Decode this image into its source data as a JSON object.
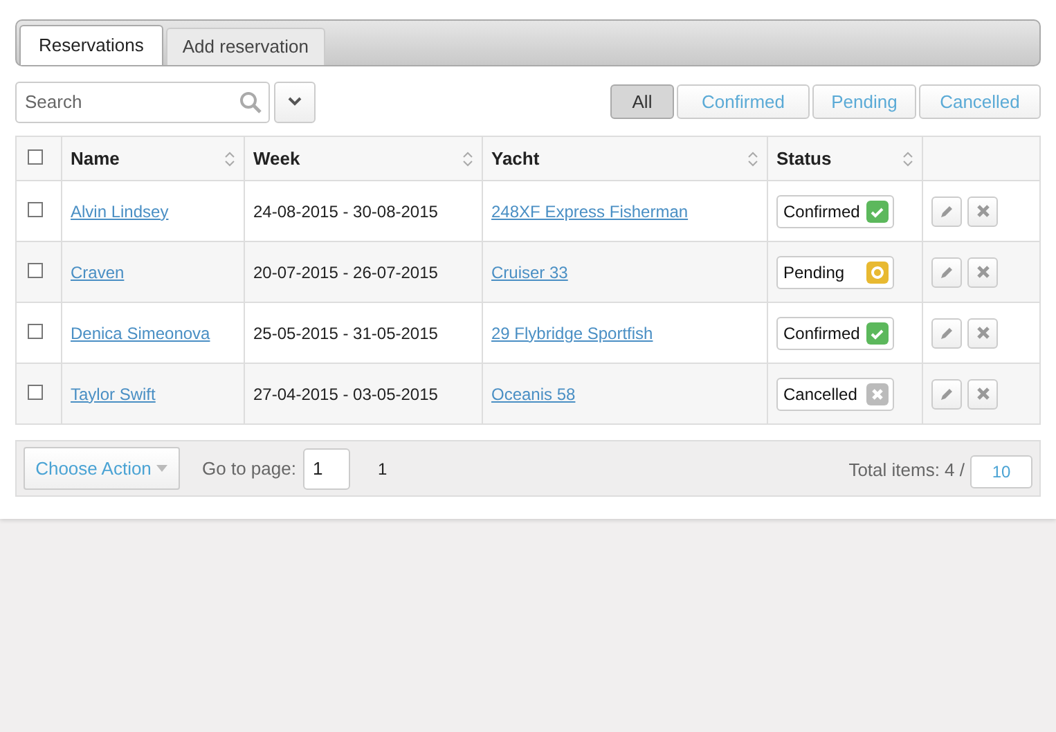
{
  "tabs": [
    {
      "label": "Reservations",
      "selected": true
    },
    {
      "label": "Add reservation",
      "selected": false
    }
  ],
  "search": {
    "placeholder": "Search"
  },
  "filters": [
    {
      "label": "All",
      "selected": true
    },
    {
      "label": "Confirmed",
      "selected": false
    },
    {
      "label": "Pending",
      "selected": false
    },
    {
      "label": "Cancelled",
      "selected": false
    }
  ],
  "table": {
    "select_all": {
      "checked": false
    },
    "columns": [
      "Name",
      "Week",
      "Yacht",
      "Status"
    ],
    "rows": [
      {
        "checked": false,
        "name": "Alvin Lindsey",
        "week": "24-08-2015 - 30-08-2015",
        "yacht": "248XF Express Fisherman",
        "status": {
          "label": "Confirmed",
          "kind": "confirmed"
        }
      },
      {
        "checked": false,
        "name": "Craven",
        "week": "20-07-2015 - 26-07-2015",
        "yacht": "Cruiser 33",
        "status": {
          "label": "Pending",
          "kind": "pending"
        }
      },
      {
        "checked": false,
        "name": "Denica Simeonova",
        "week": "25-05-2015 - 31-05-2015",
        "yacht": "29 Flybridge Sportfish",
        "status": {
          "label": "Confirmed",
          "kind": "confirmed"
        }
      },
      {
        "checked": false,
        "name": "Taylor Swift",
        "week": "27-04-2015 - 03-05-2015",
        "yacht": "Oceanis 58",
        "status": {
          "label": "Cancelled",
          "kind": "cancelled"
        }
      }
    ]
  },
  "footer": {
    "action_button": "Choose Action",
    "goto_label": "Go to page:",
    "goto_value": "1",
    "page": "1",
    "total": "Total items: 4 /",
    "page_size": "10"
  }
}
